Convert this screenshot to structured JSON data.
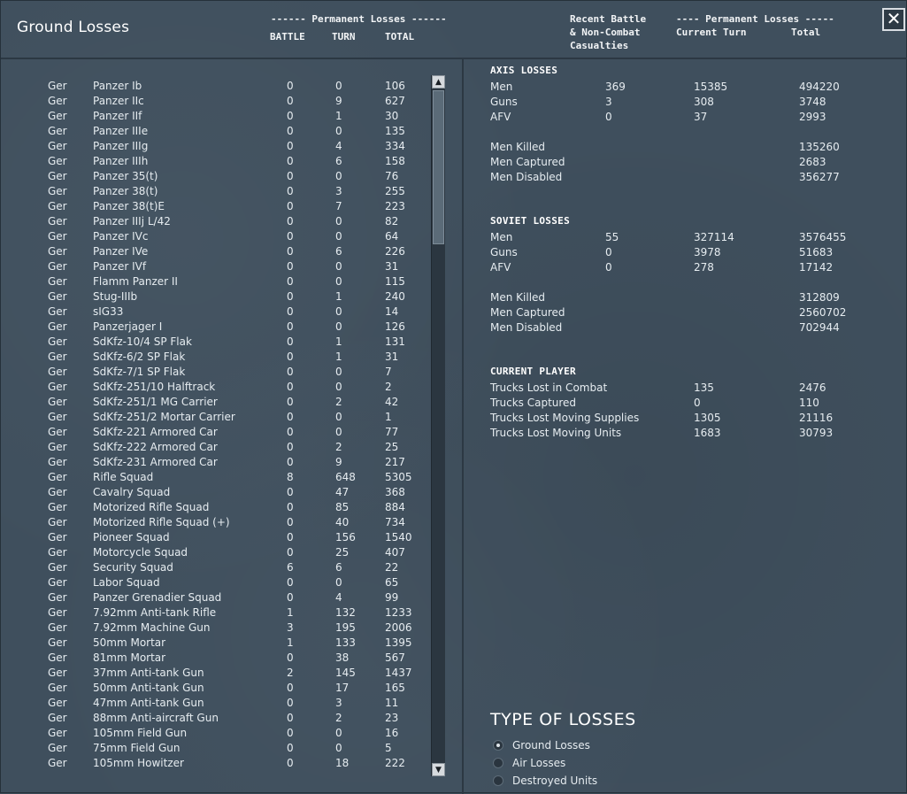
{
  "window": {
    "title": "Ground Losses",
    "close_glyph": "✕"
  },
  "headers": {
    "left_group": "------ Permanent Losses ------",
    "battle": "BATTLE",
    "turn": "TURN",
    "total": "TOTAL",
    "recent_line1": "Recent Battle",
    "recent_line2": "& Non-Combat",
    "recent_line3": "Casualties",
    "right_group": "---- Permanent Losses -----",
    "current_turn": "Current Turn",
    "right_total": "Total"
  },
  "scrollbar": {
    "up_icon": "▲",
    "down_icon": "▼"
  },
  "units": [
    {
      "nation": "Ger",
      "name": "Panzer Ib",
      "battle": "0",
      "turn": "0",
      "total": "106"
    },
    {
      "nation": "Ger",
      "name": "Panzer IIc",
      "battle": "0",
      "turn": "9",
      "total": "627"
    },
    {
      "nation": "Ger",
      "name": "Panzer IIf",
      "battle": "0",
      "turn": "1",
      "total": "30"
    },
    {
      "nation": "Ger",
      "name": "Panzer IIIe",
      "battle": "0",
      "turn": "0",
      "total": "135"
    },
    {
      "nation": "Ger",
      "name": "Panzer IIIg",
      "battle": "0",
      "turn": "4",
      "total": "334"
    },
    {
      "nation": "Ger",
      "name": "Panzer IIIh",
      "battle": "0",
      "turn": "6",
      "total": "158"
    },
    {
      "nation": "Ger",
      "name": "Panzer 35(t)",
      "battle": "0",
      "turn": "0",
      "total": "76"
    },
    {
      "nation": "Ger",
      "name": "Panzer 38(t)",
      "battle": "0",
      "turn": "3",
      "total": "255"
    },
    {
      "nation": "Ger",
      "name": "Panzer 38(t)E",
      "battle": "0",
      "turn": "7",
      "total": "223"
    },
    {
      "nation": "Ger",
      "name": "Panzer IIIj L/42",
      "battle": "0",
      "turn": "0",
      "total": "82"
    },
    {
      "nation": "Ger",
      "name": "Panzer IVc",
      "battle": "0",
      "turn": "0",
      "total": "64"
    },
    {
      "nation": "Ger",
      "name": "Panzer IVe",
      "battle": "0",
      "turn": "6",
      "total": "226"
    },
    {
      "nation": "Ger",
      "name": "Panzer IVf",
      "battle": "0",
      "turn": "0",
      "total": "31"
    },
    {
      "nation": "Ger",
      "name": "Flamm Panzer II",
      "battle": "0",
      "turn": "0",
      "total": "115"
    },
    {
      "nation": "Ger",
      "name": "Stug-IIIb",
      "battle": "0",
      "turn": "1",
      "total": "240"
    },
    {
      "nation": "Ger",
      "name": "sIG33",
      "battle": "0",
      "turn": "0",
      "total": "14"
    },
    {
      "nation": "Ger",
      "name": "Panzerjager I",
      "battle": "0",
      "turn": "0",
      "total": "126"
    },
    {
      "nation": "Ger",
      "name": "SdKfz-10/4 SP Flak",
      "battle": "0",
      "turn": "1",
      "total": "131"
    },
    {
      "nation": "Ger",
      "name": "SdKfz-6/2 SP Flak",
      "battle": "0",
      "turn": "1",
      "total": "31"
    },
    {
      "nation": "Ger",
      "name": "SdKfz-7/1 SP Flak",
      "battle": "0",
      "turn": "0",
      "total": "7"
    },
    {
      "nation": "Ger",
      "name": "SdKfz-251/10 Halftrack",
      "battle": "0",
      "turn": "0",
      "total": "2"
    },
    {
      "nation": "Ger",
      "name": "SdKfz-251/1 MG Carrier",
      "battle": "0",
      "turn": "2",
      "total": "42"
    },
    {
      "nation": "Ger",
      "name": "SdKfz-251/2 Mortar Carrier",
      "battle": "0",
      "turn": "0",
      "total": "1"
    },
    {
      "nation": "Ger",
      "name": "SdKfz-221 Armored Car",
      "battle": "0",
      "turn": "0",
      "total": "77"
    },
    {
      "nation": "Ger",
      "name": "SdKfz-222 Armored Car",
      "battle": "0",
      "turn": "2",
      "total": "25"
    },
    {
      "nation": "Ger",
      "name": "SdKfz-231 Armored Car",
      "battle": "0",
      "turn": "9",
      "total": "217"
    },
    {
      "nation": "Ger",
      "name": "Rifle Squad",
      "battle": "8",
      "turn": "648",
      "total": "5305"
    },
    {
      "nation": "Ger",
      "name": "Cavalry Squad",
      "battle": "0",
      "turn": "47",
      "total": "368"
    },
    {
      "nation": "Ger",
      "name": "Motorized Rifle Squad",
      "battle": "0",
      "turn": "85",
      "total": "884"
    },
    {
      "nation": "Ger",
      "name": "Motorized Rifle Squad (+)",
      "battle": "0",
      "turn": "40",
      "total": "734"
    },
    {
      "nation": "Ger",
      "name": "Pioneer Squad",
      "battle": "0",
      "turn": "156",
      "total": "1540"
    },
    {
      "nation": "Ger",
      "name": "Motorcycle Squad",
      "battle": "0",
      "turn": "25",
      "total": "407"
    },
    {
      "nation": "Ger",
      "name": "Security Squad",
      "battle": "6",
      "turn": "6",
      "total": "22"
    },
    {
      "nation": "Ger",
      "name": "Labor Squad",
      "battle": "0",
      "turn": "0",
      "total": "65"
    },
    {
      "nation": "Ger",
      "name": "Panzer Grenadier Squad",
      "battle": "0",
      "turn": "4",
      "total": "99"
    },
    {
      "nation": "Ger",
      "name": "7.92mm Anti-tank Rifle",
      "battle": "1",
      "turn": "132",
      "total": "1233"
    },
    {
      "nation": "Ger",
      "name": "7.92mm Machine Gun",
      "battle": "3",
      "turn": "195",
      "total": "2006"
    },
    {
      "nation": "Ger",
      "name": "50mm Mortar",
      "battle": "1",
      "turn": "133",
      "total": "1395"
    },
    {
      "nation": "Ger",
      "name": "81mm Mortar",
      "battle": "0",
      "turn": "38",
      "total": "567"
    },
    {
      "nation": "Ger",
      "name": "37mm Anti-tank Gun",
      "battle": "2",
      "turn": "145",
      "total": "1437"
    },
    {
      "nation": "Ger",
      "name": "50mm Anti-tank Gun",
      "battle": "0",
      "turn": "17",
      "total": "165"
    },
    {
      "nation": "Ger",
      "name": "47mm Anti-tank Gun",
      "battle": "0",
      "turn": "3",
      "total": "11"
    },
    {
      "nation": "Ger",
      "name": "88mm Anti-aircraft Gun",
      "battle": "0",
      "turn": "2",
      "total": "23"
    },
    {
      "nation": "Ger",
      "name": "105mm Field Gun",
      "battle": "0",
      "turn": "0",
      "total": "16"
    },
    {
      "nation": "Ger",
      "name": "75mm Field Gun",
      "battle": "0",
      "turn": "0",
      "total": "5"
    },
    {
      "nation": "Ger",
      "name": "105mm Howitzer",
      "battle": "0",
      "turn": "18",
      "total": "222"
    }
  ],
  "axis": {
    "title": "AXIS LOSSES",
    "rows": [
      {
        "label": "Men",
        "battle": "369",
        "turn": "15385",
        "total": "494220"
      },
      {
        "label": "Guns",
        "battle": "3",
        "turn": "308",
        "total": "3748"
      },
      {
        "label": "AFV",
        "battle": "0",
        "turn": "37",
        "total": "2993"
      }
    ],
    "detail": [
      {
        "label": "Men Killed",
        "total": "135260"
      },
      {
        "label": "Men Captured",
        "total": "2683"
      },
      {
        "label": "Men Disabled",
        "total": "356277"
      }
    ]
  },
  "soviet": {
    "title": "SOVIET LOSSES",
    "rows": [
      {
        "label": "Men",
        "battle": "55",
        "turn": "327114",
        "total": "3576455"
      },
      {
        "label": "Guns",
        "battle": "0",
        "turn": "3978",
        "total": "51683"
      },
      {
        "label": "AFV",
        "battle": "0",
        "turn": "278",
        "total": "17142"
      }
    ],
    "detail": [
      {
        "label": "Men Killed",
        "total": "312809"
      },
      {
        "label": "Men Captured",
        "total": "2560702"
      },
      {
        "label": "Men Disabled",
        "total": "702944"
      }
    ]
  },
  "player": {
    "title": "CURRENT PLAYER",
    "rows": [
      {
        "label": "Trucks Lost in Combat",
        "turn": "135",
        "total": "2476"
      },
      {
        "label": "Trucks Captured",
        "turn": "0",
        "total": "110"
      },
      {
        "label": "Trucks Lost Moving Supplies",
        "turn": "1305",
        "total": "21116"
      },
      {
        "label": "Trucks Lost Moving Units",
        "turn": "1683",
        "total": "30793"
      }
    ]
  },
  "type_of_losses": {
    "title": "TYPE OF LOSSES",
    "options": [
      {
        "label": "Ground Losses",
        "selected": true
      },
      {
        "label": "Air Losses",
        "selected": false
      },
      {
        "label": "Destroyed Units",
        "selected": false
      }
    ]
  }
}
